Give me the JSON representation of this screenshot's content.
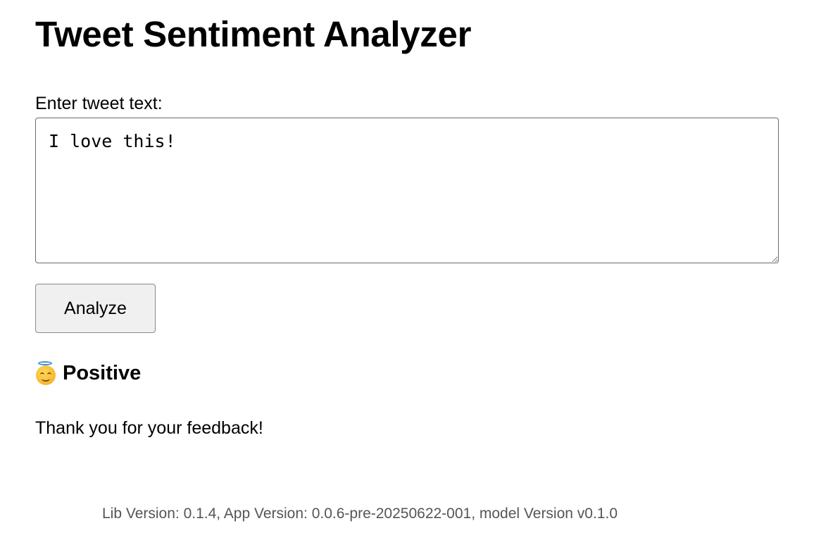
{
  "app": {
    "title": "Tweet Sentiment Analyzer"
  },
  "form": {
    "label": "Enter tweet text:",
    "tweet_value": "I love this!",
    "analyze_label": "Analyze"
  },
  "result": {
    "emoji_icon": "smiling-face-with-halo-icon",
    "sentiment": "Positive",
    "feedback_message": "Thank you for your feedback!"
  },
  "footer": {
    "version_text": "Lib Version: 0.1.4, App Version: 0.0.6-pre-20250622-001, model Version v0.1.0"
  },
  "colors": {
    "halo": "#3d8fe0",
    "face": "#f7b731",
    "button_bg": "#f0f0f0",
    "footer_text": "#555555"
  }
}
